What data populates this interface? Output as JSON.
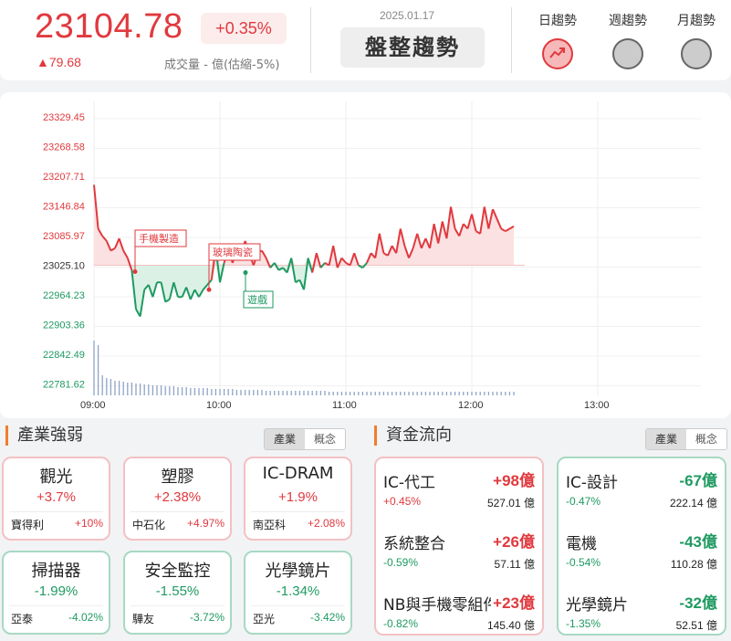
{
  "header": {
    "price": "23104.78",
    "change_pct": "+0.35%",
    "change": "▲79.68",
    "volume": "成交量 - 億(估縮-5%)",
    "date": "2025.01.17",
    "trend_status": "盤整趨勢",
    "tabs": [
      {
        "label": "日趨勢",
        "active": true,
        "icon": "trend-up-icon"
      },
      {
        "label": "週趨勢",
        "active": false
      },
      {
        "label": "月趨勢",
        "active": false
      }
    ]
  },
  "chart_data": {
    "type": "line",
    "baseline": 23025.1,
    "y_ticks": [
      "23329.45",
      "23268.58",
      "23207.71",
      "23146.84",
      "23085.97",
      "23025.10",
      "22964.23",
      "22903.36",
      "22842.49",
      "22781.62"
    ],
    "x_ticks": [
      "09:00",
      "10:00",
      "11:00",
      "12:00",
      "13:00"
    ],
    "annotations": [
      "手機製造",
      "玻璃陶瓷",
      "遊戲"
    ],
    "series_minutes": [
      0,
      2,
      4,
      6,
      8,
      10,
      12,
      14,
      16,
      18,
      20,
      22,
      24,
      26,
      28,
      30,
      32,
      34,
      36,
      38,
      40,
      42,
      44,
      46,
      48,
      50,
      52,
      54,
      56,
      58,
      60,
      62,
      64,
      66,
      68,
      70,
      72,
      74,
      76,
      78,
      80,
      82,
      84,
      86,
      88,
      90,
      92,
      94,
      96,
      98,
      100,
      102,
      104,
      106,
      108,
      110,
      112,
      114,
      116,
      118,
      120,
      122,
      124,
      126,
      128,
      130,
      132,
      134,
      136,
      138,
      140,
      142,
      144,
      146,
      148,
      150,
      152,
      154,
      156,
      158,
      160,
      162,
      164,
      166,
      168,
      170,
      172,
      174,
      176,
      178,
      180,
      182,
      184,
      186,
      188,
      190,
      192,
      194,
      196,
      198,
      200
    ],
    "series_values": [
      23190,
      23100,
      23085,
      23075,
      23055,
      23060,
      23080,
      23055,
      23040,
      23015,
      22935,
      22920,
      22975,
      22985,
      22960,
      22990,
      22990,
      22950,
      22955,
      22990,
      22960,
      22960,
      22980,
      22955,
      22975,
      22960,
      22975,
      22985,
      22995,
      23060,
      22990,
      23030,
      23060,
      23030,
      23055,
      23045,
      23075,
      23050,
      23025,
      23050,
      23055,
      23040,
      23020,
      23030,
      23015,
      23020,
      23010,
      23040,
      22990,
      22995,
      22975,
      23040,
      23010,
      23050,
      23020,
      23030,
      23025,
      23065,
      23020,
      23040,
      23030,
      23025,
      23050,
      23025,
      23020,
      23030,
      23050,
      23040,
      23090,
      23050,
      23045,
      23065,
      23050,
      23100,
      23065,
      23040,
      23060,
      23090,
      23060,
      23080,
      23060,
      23110,
      23070,
      23115,
      23080,
      23145,
      23100,
      23085,
      23110,
      23100,
      23130,
      23095,
      23090,
      23145,
      23100,
      23140,
      23120,
      23100,
      23095,
      23100,
      23105
    ],
    "volume_bars": [
      60,
      55,
      22,
      19,
      18,
      16,
      16,
      15,
      14,
      14,
      13,
      13,
      12,
      12,
      11,
      11,
      11,
      10,
      10,
      10,
      9,
      9,
      9,
      8,
      8,
      8,
      8,
      8,
      7,
      7,
      7,
      7,
      7,
      7,
      6,
      6,
      6,
      6,
      6,
      6,
      6,
      5,
      5,
      5,
      5,
      5,
      5,
      5,
      5,
      5,
      5,
      5,
      5,
      5,
      5,
      5,
      4,
      4,
      4,
      4,
      4,
      4,
      4,
      4,
      4,
      4,
      4,
      4,
      4,
      4,
      4,
      4,
      4,
      4,
      4,
      4,
      4,
      4,
      4,
      4,
      4,
      4,
      4,
      4,
      4,
      4,
      4,
      4,
      4,
      4,
      4,
      4,
      4,
      4,
      4,
      4,
      4,
      4,
      4,
      4,
      4
    ]
  },
  "industry": {
    "title": "產業強弱",
    "tabs": [
      "產業",
      "概念"
    ],
    "items": [
      {
        "name": "觀光",
        "pct": "+3.7%",
        "stock": "寶得利",
        "stock_pct": "+10%",
        "dir": "up"
      },
      {
        "name": "塑膠",
        "pct": "+2.38%",
        "stock": "中石化",
        "stock_pct": "+4.97%",
        "dir": "up"
      },
      {
        "name": "IC-DRAM",
        "pct": "+1.9%",
        "stock": "南亞科",
        "stock_pct": "+2.08%",
        "dir": "up"
      },
      {
        "name": "掃描器",
        "pct": "-1.99%",
        "stock": "亞泰",
        "stock_pct": "-4.02%",
        "dir": "dn"
      },
      {
        "name": "安全監控",
        "pct": "-1.55%",
        "stock": "驊友",
        "stock_pct": "-3.72%",
        "dir": "dn"
      },
      {
        "name": "光學鏡片",
        "pct": "-1.34%",
        "stock": "亞光",
        "stock_pct": "-3.42%",
        "dir": "dn"
      }
    ]
  },
  "fund_flow": {
    "title": "資金流向",
    "tabs": [
      "產業",
      "概念"
    ],
    "inflow": [
      {
        "name": "IC-代工",
        "amount": "+98億",
        "pct": "+0.45%",
        "value": "527.01 億"
      },
      {
        "name": "系統整合",
        "amount": "+26億",
        "pct": "-0.59%",
        "value": "57.11 億"
      },
      {
        "name": "NB與手機零組件",
        "amount": "+23億",
        "pct": "-0.82%",
        "value": "145.40 億"
      }
    ],
    "outflow": [
      {
        "name": "IC-設計",
        "amount": "-67億",
        "pct": "-0.47%",
        "value": "222.14 億"
      },
      {
        "name": "電機",
        "amount": "-43億",
        "pct": "-0.54%",
        "value": "110.28 億"
      },
      {
        "name": "光學鏡片",
        "amount": "-32億",
        "pct": "-1.35%",
        "value": "52.51 億"
      }
    ]
  },
  "colors": {
    "up": "#e0393e",
    "down": "#1f9a62",
    "accent": "#f07d2e"
  }
}
